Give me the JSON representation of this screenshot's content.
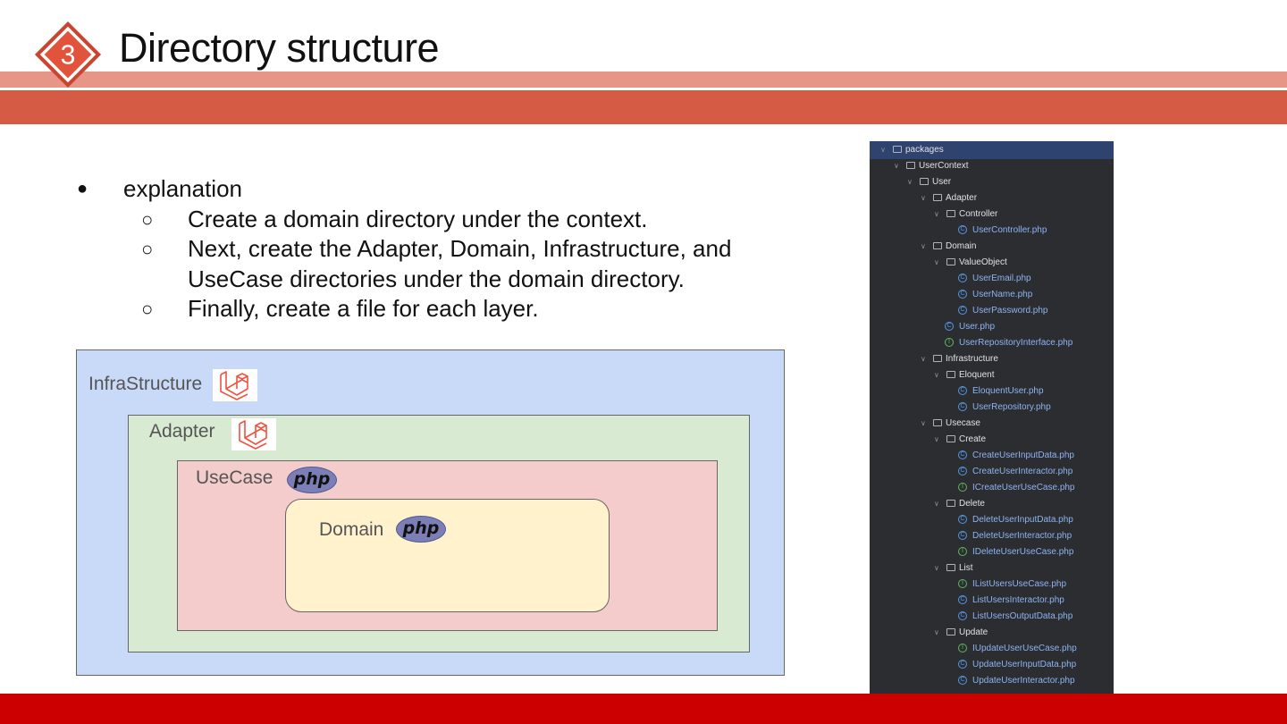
{
  "slide": {
    "number": "3",
    "title": "Directory structure",
    "colors": {
      "accent_light": "#e79586",
      "accent": "#d55b44",
      "footer": "#cc0000",
      "badge": "#e2533b"
    }
  },
  "bullets": {
    "main": "explanation",
    "sub": [
      "Create a domain directory under the context.",
      "Next, create the Adapter, Domain, Infrastructure, and UseCase directories under the domain directory.",
      "Finally, create a file for each layer."
    ]
  },
  "diagram": {
    "layers": [
      {
        "label": "InfraStructure",
        "logo": "laravel-icon",
        "color": "#c9daf8"
      },
      {
        "label": "Adapter",
        "logo": "laravel-icon",
        "color": "#d9ead3"
      },
      {
        "label": "UseCase",
        "logo": "php-icon",
        "color": "#f4cccc"
      },
      {
        "label": "Domain",
        "logo": "php-icon",
        "color": "#fff2cc"
      }
    ],
    "php_text": "php"
  },
  "tree": [
    {
      "name": "packages",
      "type": "folder",
      "depth": 0
    },
    {
      "name": "UserContext",
      "type": "folder",
      "depth": 1
    },
    {
      "name": "User",
      "type": "folder",
      "depth": 2
    },
    {
      "name": "Adapter",
      "type": "folder",
      "depth": 3
    },
    {
      "name": "Controller",
      "type": "folder",
      "depth": 4
    },
    {
      "name": "UserController.php",
      "type": "class",
      "depth": 5
    },
    {
      "name": "Domain",
      "type": "folder",
      "depth": 3
    },
    {
      "name": "ValueObject",
      "type": "folder",
      "depth": 4
    },
    {
      "name": "UserEmail.php",
      "type": "class",
      "depth": 5
    },
    {
      "name": "UserName.php",
      "type": "class",
      "depth": 5
    },
    {
      "name": "UserPassword.php",
      "type": "class",
      "depth": 5
    },
    {
      "name": "User.php",
      "type": "class",
      "depth": 4
    },
    {
      "name": "UserRepositoryInterface.php",
      "type": "interface",
      "depth": 4
    },
    {
      "name": "Infrastructure",
      "type": "folder",
      "depth": 3
    },
    {
      "name": "Eloquent",
      "type": "folder",
      "depth": 4
    },
    {
      "name": "EloquentUser.php",
      "type": "class",
      "depth": 5
    },
    {
      "name": "UserRepository.php",
      "type": "class",
      "depth": 5
    },
    {
      "name": "Usecase",
      "type": "folder",
      "depth": 3
    },
    {
      "name": "Create",
      "type": "folder",
      "depth": 4
    },
    {
      "name": "CreateUserInputData.php",
      "type": "class",
      "depth": 5
    },
    {
      "name": "CreateUserInteractor.php",
      "type": "class",
      "depth": 5
    },
    {
      "name": "ICreateUserUseCase.php",
      "type": "interface",
      "depth": 5
    },
    {
      "name": "Delete",
      "type": "folder",
      "depth": 4
    },
    {
      "name": "DeleteUserInputData.php",
      "type": "class",
      "depth": 5
    },
    {
      "name": "DeleteUserInteractor.php",
      "type": "class",
      "depth": 5
    },
    {
      "name": "IDeleteUserUseCase.php",
      "type": "interface",
      "depth": 5
    },
    {
      "name": "List",
      "type": "folder",
      "depth": 4
    },
    {
      "name": "IListUsersUseCase.php",
      "type": "interface",
      "depth": 5
    },
    {
      "name": "ListUsersInteractor.php",
      "type": "class",
      "depth": 5
    },
    {
      "name": "ListUsersOutputData.php",
      "type": "class",
      "depth": 5
    },
    {
      "name": "Update",
      "type": "folder",
      "depth": 4
    },
    {
      "name": "IUpdateUserUseCase.php",
      "type": "interface",
      "depth": 5
    },
    {
      "name": "UpdateUserInputData.php",
      "type": "class",
      "depth": 5
    },
    {
      "name": "UpdateUserInteractor.php",
      "type": "class",
      "depth": 5
    }
  ]
}
